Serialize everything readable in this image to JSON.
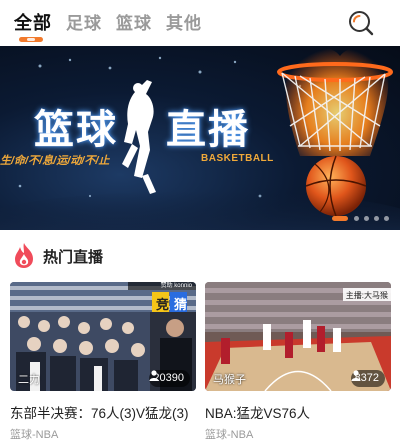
{
  "tabs": [
    {
      "label": "全部",
      "active": true
    },
    {
      "label": "足球",
      "active": false
    },
    {
      "label": "篮球",
      "active": false
    },
    {
      "label": "其他",
      "active": false
    }
  ],
  "search": {
    "icon": "search-icon"
  },
  "banner": {
    "title_left": "篮球",
    "title_right": "直播",
    "slogan": "生/命/不/息/运/动/不/止",
    "english": "BASKETBALL",
    "slides": 5,
    "active_slide": 1
  },
  "section": {
    "title": "热门直播",
    "icon": "flame-icon"
  },
  "cards": [
    {
      "anchor": "二力",
      "viewers": "20390",
      "title": "东部半决赛：76人(3)V猛龙(3)",
      "category": "篮球-NBA",
      "badge_left": "竞",
      "badge_right": "猜",
      "corner_text": "赞助 konnio"
    },
    {
      "anchor": "马猴子",
      "viewers": "8372",
      "title": "NBA:猛龙VS76人",
      "category": "篮球-NBA",
      "corner_text": "主播:大马猴"
    }
  ],
  "colors": {
    "accent": "#f27a2c",
    "muted": "#9a9a9a",
    "text": "#222222"
  }
}
